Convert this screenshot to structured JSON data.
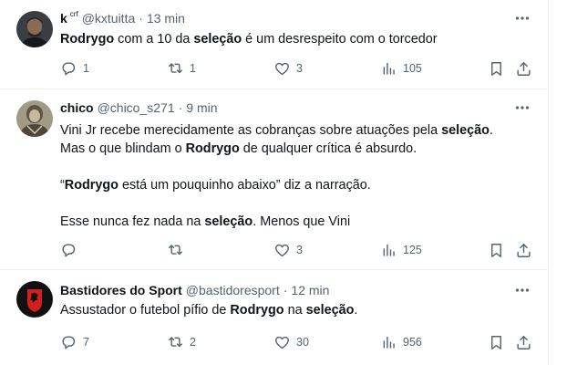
{
  "tweets": [
    {
      "name": "k",
      "name_suffix": "crf",
      "handle": "@kxtuitta",
      "separator": "·",
      "time": "13 min",
      "lines": [
        [
          {
            "t": "Rodrygo",
            "b": true
          },
          {
            "t": " com a 10 da ",
            "b": false
          },
          {
            "t": "seleção",
            "b": true
          },
          {
            "t": " é um desrespeito com o torcedor",
            "b": false
          }
        ]
      ],
      "replies": "1",
      "reposts": "1",
      "likes": "3",
      "views": "105"
    },
    {
      "name": "chico",
      "name_suffix": "",
      "handle": "@chico_s271",
      "separator": "·",
      "time": "9 min",
      "lines": [
        [
          {
            "t": "Vini Jr recebe merecidamente as cobranças sobre atuações pela ",
            "b": false
          },
          {
            "t": "seleção",
            "b": true
          },
          {
            "t": ".",
            "b": false
          }
        ],
        [
          {
            "t": "Mas o que blindam o ",
            "b": false
          },
          {
            "t": "Rodrygo",
            "b": true
          },
          {
            "t": " de qualquer crítica é absurdo.",
            "b": false
          }
        ],
        [],
        [
          {
            "t": "“",
            "b": false
          },
          {
            "t": "Rodrygo",
            "b": true
          },
          {
            "t": " está um pouquinho abaixo” diz a narração.",
            "b": false
          }
        ],
        [],
        [
          {
            "t": "Esse nunca fez nada na ",
            "b": false
          },
          {
            "t": "seleção",
            "b": true
          },
          {
            "t": ". Menos que Vini",
            "b": false
          }
        ]
      ],
      "replies": "",
      "reposts": "",
      "likes": "3",
      "views": "125"
    },
    {
      "name": "Bastidores do Sport",
      "name_suffix": "",
      "handle": "@bastidoresport",
      "separator": "·",
      "time": "12 min",
      "lines": [
        [
          {
            "t": "Assustador o futebol pífio de ",
            "b": false
          },
          {
            "t": "Rodrygo",
            "b": true
          },
          {
            "t": " na ",
            "b": false
          },
          {
            "t": "seleção",
            "b": true
          },
          {
            "t": ".",
            "b": false
          }
        ]
      ],
      "replies": "7",
      "reposts": "2",
      "likes": "30",
      "views": "956"
    }
  ],
  "icons": {
    "reply": "reply-icon",
    "repost": "repost-icon",
    "like": "heart-icon",
    "views": "views-icon",
    "bookmark": "bookmark-icon",
    "share": "share-icon",
    "more": "more-icon"
  },
  "colors": {
    "text": "#0f1419",
    "secondary": "#536471",
    "divider": "#eff3f4"
  }
}
